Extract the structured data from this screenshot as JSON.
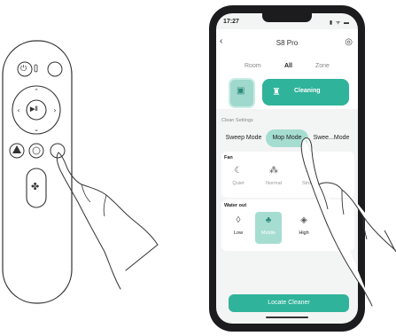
{
  "phone": {
    "status_time": "17:27",
    "status_icons": "▮ ᯤ ▬",
    "back_icon": "‹",
    "title": "S8 Pro",
    "settings_icon": "◎",
    "tabs": [
      {
        "label": "Room",
        "active": false
      },
      {
        "label": "All",
        "active": true
      },
      {
        "label": "Zone",
        "active": false
      }
    ],
    "room_button_icon": "▣",
    "clean_button_icon": "♜",
    "clean_button_label": "Cleaning",
    "clean_settings_label": "Clean Settings",
    "modes": [
      {
        "label": "Sweep Mode",
        "active": false
      },
      {
        "label": "Mop Mode",
        "active": true
      },
      {
        "label": "Swee...Mode",
        "active": false
      }
    ],
    "fan_label": "Fan",
    "fan_options": [
      {
        "label": "Quiet",
        "icon": "☾"
      },
      {
        "label": "Normal",
        "icon": "⁂"
      },
      {
        "label": "Strong",
        "icon": "✻"
      }
    ],
    "water_label": "Water out",
    "water_options": [
      {
        "label": "Low",
        "icon": "◊"
      },
      {
        "label": "Middle",
        "icon": "♣"
      },
      {
        "label": "High",
        "icon": "◈"
      }
    ],
    "locate_button": "Locate Cleaner"
  },
  "remote": {
    "power_icon": "⏻",
    "play_pause_icon": "▶ǁ",
    "fan_icon": "✤"
  },
  "colors": {
    "accent": "#2fb39a",
    "accent_light": "#a6ddd1"
  }
}
